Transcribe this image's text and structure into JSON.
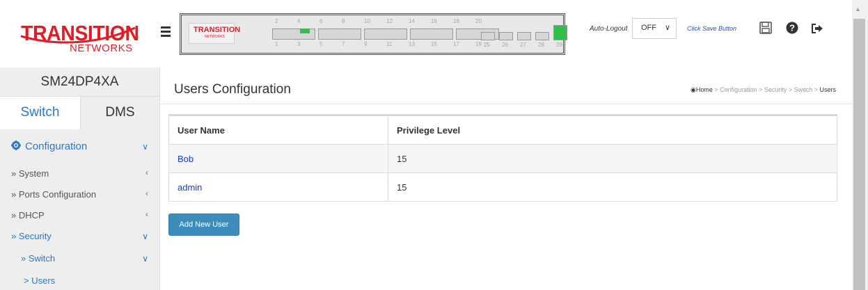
{
  "brand": {
    "line1": "TRANSITION",
    "line2": "NETWORKS"
  },
  "device_panel": {
    "logo_text": "TRANSITION",
    "logo_sub": "NETWORKS",
    "top_ports": [
      "2",
      "4",
      "6",
      "8",
      "10",
      "12",
      "14",
      "16",
      "18",
      "20"
    ],
    "bottom_ports": [
      "1",
      "3",
      "5",
      "7",
      "9",
      "11",
      "13",
      "15",
      "17",
      "19"
    ],
    "sfp_ports": [
      "25",
      "26",
      "27",
      "28",
      "29"
    ]
  },
  "header": {
    "autologout_label": "Auto-Logout",
    "autologout_value": "OFF",
    "save_note": "Click Save Button"
  },
  "sidebar": {
    "device_name": "SM24DP4XA",
    "tabs": [
      "Switch",
      "DMS"
    ],
    "items": [
      {
        "label": "Configuration"
      },
      {
        "label": "» System"
      },
      {
        "label": "» Ports Configuration"
      },
      {
        "label": "» DHCP"
      },
      {
        "label": "» Security"
      },
      {
        "label": "» Switch"
      },
      {
        "label": "> Users"
      }
    ]
  },
  "main": {
    "title": "Users Configuration",
    "breadcrumb": [
      "Home",
      "Configuration",
      "Security",
      "Switch",
      "Users"
    ],
    "table": {
      "columns": [
        "User Name",
        "Privilege Level"
      ],
      "rows": [
        {
          "user": "Bob",
          "level": "15"
        },
        {
          "user": "admin",
          "level": "15"
        }
      ]
    },
    "add_button": "Add New User"
  },
  "colors": {
    "accent": "#3c8dbc",
    "brand_red": "#e31b23",
    "link": "#1a3ccf",
    "active_tab": "#2a78c8",
    "port_active": "#2fbf4a"
  }
}
